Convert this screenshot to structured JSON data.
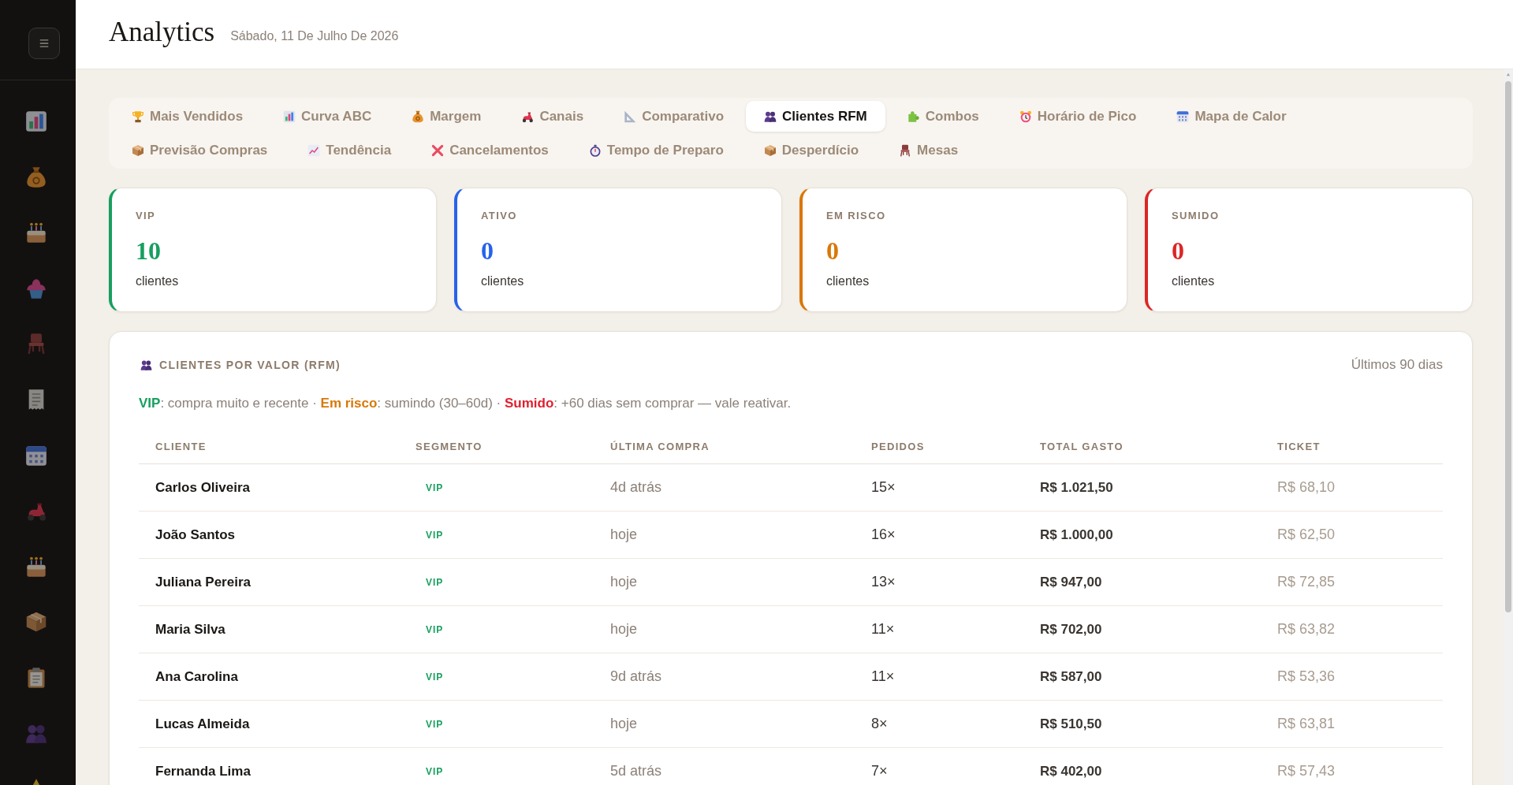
{
  "header": {
    "title": "Analytics",
    "date": "Sábado, 11 De Julho De 2026"
  },
  "tabs": [
    {
      "label": "Mais Vendidos",
      "selected": false
    },
    {
      "label": "Curva ABC",
      "selected": false
    },
    {
      "label": "Margem",
      "selected": false
    },
    {
      "label": "Canais",
      "selected": false
    },
    {
      "label": "Comparativo",
      "selected": false
    },
    {
      "label": "Clientes RFM",
      "selected": true
    },
    {
      "label": "Combos",
      "selected": false
    },
    {
      "label": "Horário de Pico",
      "selected": false
    },
    {
      "label": "Mapa de Calor",
      "selected": false
    },
    {
      "label": "Previsão Compras",
      "selected": false
    },
    {
      "label": "Tendência",
      "selected": false
    },
    {
      "label": "Cancelamentos",
      "selected": false
    },
    {
      "label": "Tempo de Preparo",
      "selected": false
    },
    {
      "label": "Desperdício",
      "selected": false
    },
    {
      "label": "Mesas",
      "selected": false
    }
  ],
  "segment_cards": [
    {
      "label": "VIP",
      "count": "10",
      "caption": "clientes",
      "color": "#179f5f"
    },
    {
      "label": "ATIVO",
      "count": "0",
      "caption": "clientes",
      "color": "#2563eb"
    },
    {
      "label": "EM RISCO",
      "count": "0",
      "caption": "clientes",
      "color": "#d97706"
    },
    {
      "label": "SUMIDO",
      "count": "0",
      "caption": "clientes",
      "color": "#dc2626"
    }
  ],
  "rfm_panel": {
    "title": "CLIENTES POR VALOR (RFM)",
    "period": "Últimos 90 dias",
    "legend": [
      {
        "term": "VIP",
        "color": "#179f5f",
        "text": ": compra muito e recente · "
      },
      {
        "term": "Em risco",
        "color": "#d97706",
        "text": ": sumindo (30–60d) · "
      },
      {
        "term": "Sumido",
        "color": "#e0202e",
        "text": ": +60 dias sem comprar — vale reativar."
      }
    ],
    "columns": [
      "CLIENTE",
      "SEGMENTO",
      "ÚLTIMA COMPRA",
      "PEDIDOS",
      "TOTAL GASTO",
      "TICKET"
    ],
    "rows": [
      {
        "client": "Carlos Oliveira",
        "segment": "VIP",
        "color": "#179f5f",
        "last_purchase": "4d atrás",
        "orders": "15×",
        "total_spent": "R$ 1.021,50",
        "ticket": "R$ 68,10"
      },
      {
        "client": "João Santos",
        "segment": "VIP",
        "color": "#179f5f",
        "last_purchase": "hoje",
        "orders": "16×",
        "total_spent": "R$ 1.000,00",
        "ticket": "R$ 62,50"
      },
      {
        "client": "Juliana Pereira",
        "segment": "VIP",
        "color": "#179f5f",
        "last_purchase": "hoje",
        "orders": "13×",
        "total_spent": "R$ 947,00",
        "ticket": "R$ 72,85"
      },
      {
        "client": "Maria Silva",
        "segment": "VIP",
        "color": "#179f5f",
        "last_purchase": "hoje",
        "orders": "11×",
        "total_spent": "R$ 702,00",
        "ticket": "R$ 63,82"
      },
      {
        "client": "Ana Carolina",
        "segment": "VIP",
        "color": "#179f5f",
        "last_purchase": "9d atrás",
        "orders": "11×",
        "total_spent": "R$ 587,00",
        "ticket": "R$ 53,36"
      },
      {
        "client": "Lucas Almeida",
        "segment": "VIP",
        "color": "#179f5f",
        "last_purchase": "hoje",
        "orders": "8×",
        "total_spent": "R$ 510,50",
        "ticket": "R$ 63,81"
      },
      {
        "client": "Fernanda Lima",
        "segment": "VIP",
        "color": "#179f5f",
        "last_purchase": "5d atrás",
        "orders": "7×",
        "total_spent": "R$ 402,00",
        "ticket": "R$ 57,43"
      }
    ]
  }
}
